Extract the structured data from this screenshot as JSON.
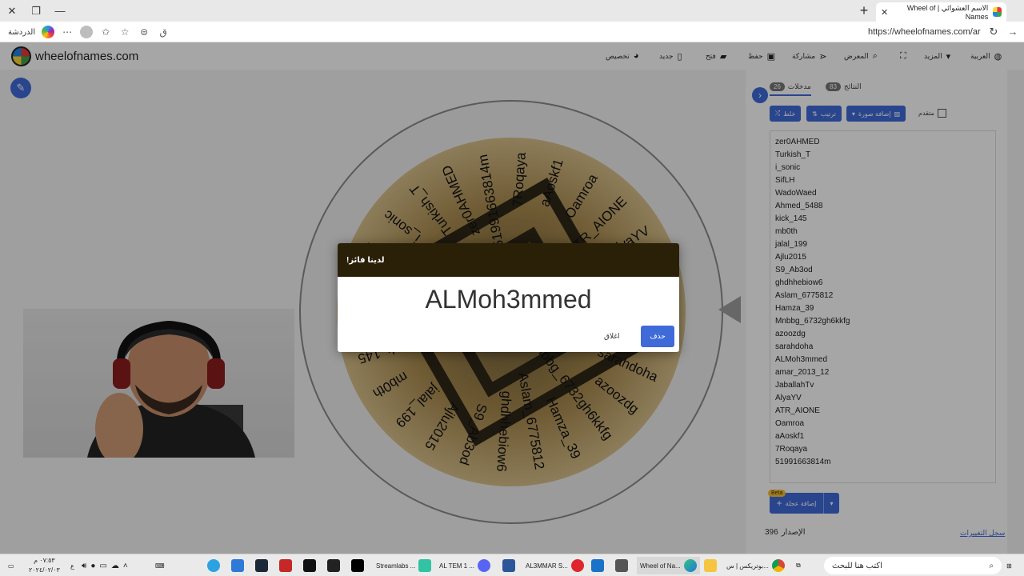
{
  "browser": {
    "tab_title": "الاسم العشوائي | Wheel of Names",
    "tab_close": "✕",
    "new_tab": "+",
    "url": "https://wheelofnames.com/ar",
    "left_label": "الدردشة",
    "win_close": "✕",
    "win_restore": "❐",
    "win_min": "—"
  },
  "header": {
    "site_name": "wheelofnames.com",
    "menu": {
      "customize": "تخصيص",
      "new": "جديد",
      "open": "فتح",
      "save": "حفظ",
      "share": "مشاركة",
      "gallery": "المعرض",
      "more": "المزيد",
      "language": "العربية"
    }
  },
  "wheel": {
    "labels": [
      "51991663814m",
      "7Roqaya",
      "aAoskf1",
      "Oamroa",
      "ATR_AIONE",
      "AlyaYV",
      "JaballahTV",
      "amar_2013_12",
      "ALMoh3mmed",
      "sarahdoha",
      "azoozdg",
      "Mnbbg_6732gh6kkfg",
      "Hamza_39",
      "Aslam_6775812",
      "ghdhhebiow6",
      "S9_Ab3od",
      "Ajlu2015",
      "jalal_199",
      "mb0th",
      "kick_145",
      "Ahmed_5488",
      "WadoWaed",
      "SifLH",
      "i_sonic",
      "Turkish_T",
      "zer0AHMED"
    ]
  },
  "panel": {
    "entries_tab": "مدخلات",
    "entries_count": "26",
    "results_tab": "النتائج",
    "results_count": "83",
    "shuffle": "خلط",
    "sort": "ترتيب",
    "add_image": "إضافة صورة",
    "advanced": "متقدم",
    "entries": [
      "zer0AHMED",
      "Turkish_T",
      "i_sonic",
      "SifLH",
      "WadoWaed",
      "Ahmed_5488",
      "kick_145",
      "mb0th",
      "jalal_199",
      "Ajlu2015",
      "S9_Ab3od",
      "ghdhhebiow6",
      "Aslam_6775812",
      "Hamza_39",
      "Mnbbg_6732gh6kkfg",
      "azoozdg",
      "sarahdoha",
      "ALMoh3mmed",
      "amar_2013_12",
      "JaballahTv",
      "AlyaYV",
      "ATR_AIONE",
      "Oamroa",
      "aAoskf1",
      "7Roqaya",
      "51991663814m"
    ],
    "add_wheel": "إضافة عجلة",
    "beta": "Beta",
    "version_label": "الإصدار",
    "version": "396",
    "changelog": "سجل التغييرات"
  },
  "dialog": {
    "title": "لدينا فائز!",
    "winner": "ALMoh3mmed",
    "close": "اغلاق",
    "remove": "حذف"
  },
  "taskbar": {
    "search": "اكتب هنا للبحث",
    "items": [
      "بوتريكس | س...",
      "Wheel of Na...",
      "AL3MMAR S...",
      "AL TEM 1 ...",
      "Streamlabs ..."
    ],
    "time": "٠٧:٥٣ م",
    "date": "٢٠٢٤/٠٢/٠٣",
    "lang": "ع"
  },
  "colors": {
    "accent": "#3f6bd9",
    "dialog_header": "#2a2008",
    "wheel_gold": "#c9a45c",
    "wheel_dark": "#3a3324"
  }
}
